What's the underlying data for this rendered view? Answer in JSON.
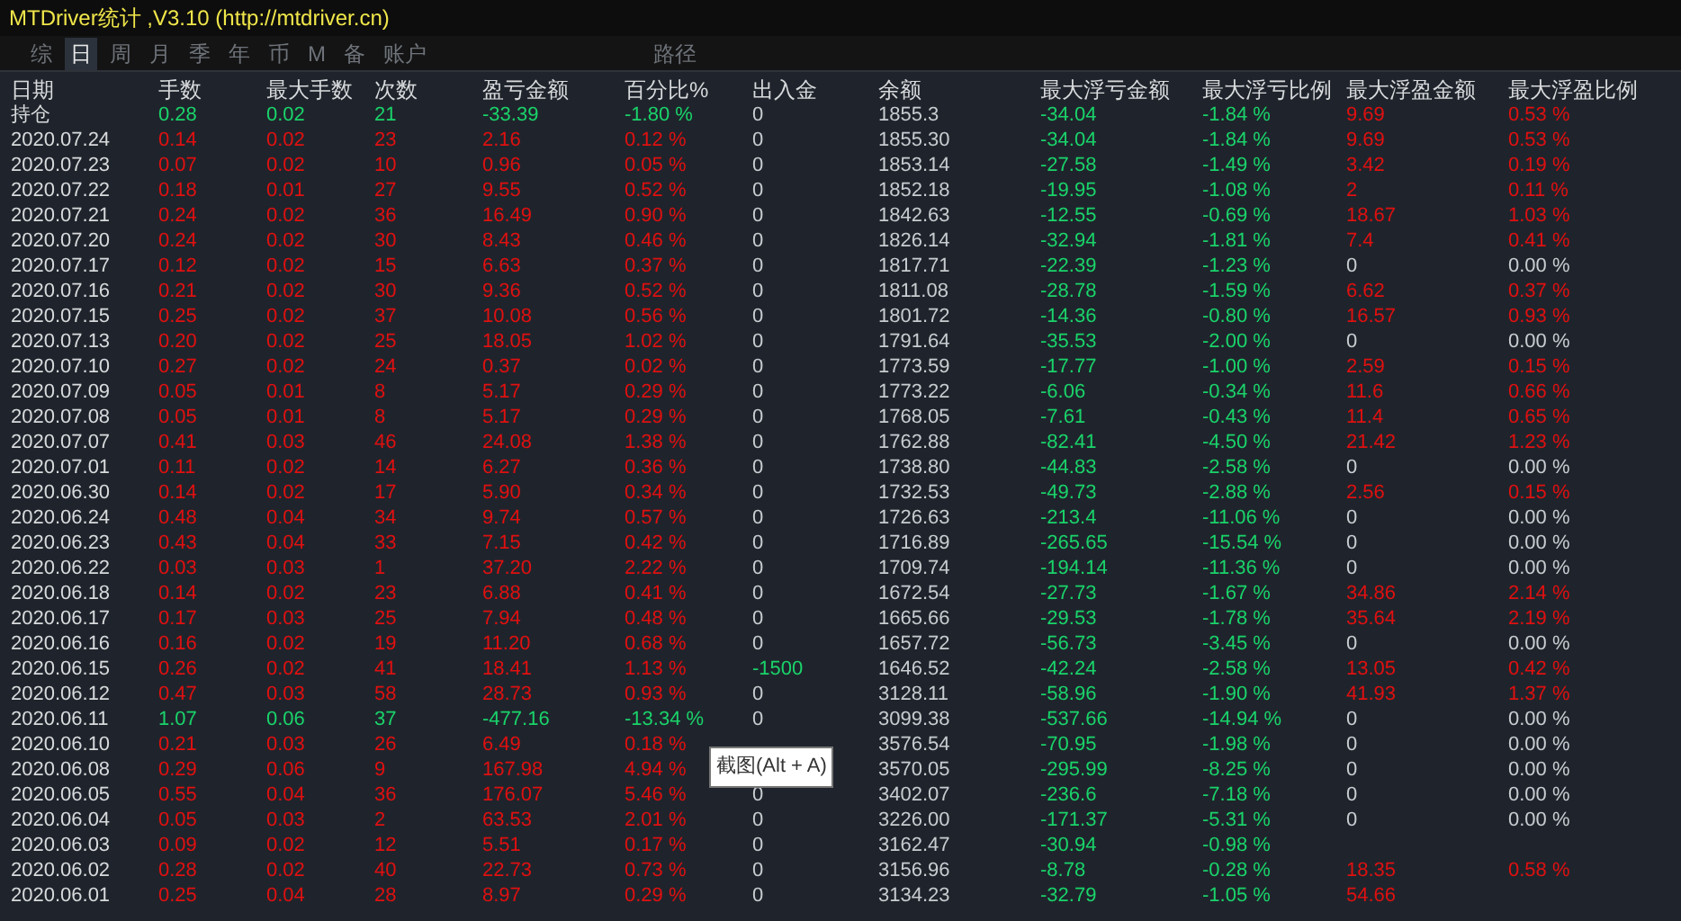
{
  "window": {
    "title": "MTDriver统计 ,V3.10 (http://mtdriver.cn)"
  },
  "tabs": [
    {
      "label": "综",
      "selected": false
    },
    {
      "label": "日",
      "selected": true
    },
    {
      "label": "周",
      "selected": false
    },
    {
      "label": "月",
      "selected": false
    },
    {
      "label": "季",
      "selected": false
    },
    {
      "label": "年",
      "selected": false
    },
    {
      "label": "币",
      "selected": false
    },
    {
      "label": "M",
      "selected": false
    },
    {
      "label": "备",
      "selected": false
    },
    {
      "label": "账户",
      "selected": false
    }
  ],
  "path_button": "路径",
  "table": {
    "columns": [
      "日期",
      "手数",
      "最大手数",
      "次数",
      "盈亏金额",
      "百分比%",
      "出入金",
      "余额",
      "最大浮亏金额",
      "最大浮亏比例",
      "最大浮盈金额",
      "最大浮盈比例"
    ],
    "rows": [
      {
        "profit": false,
        "withdrawal": false,
        "float_gain": true,
        "cells": [
          "持仓",
          "0.28",
          "0.02",
          "21",
          "-33.39",
          "-1.80 %",
          "0",
          "1855.3",
          "-34.04",
          "-1.84 %",
          "9.69",
          "0.53 %"
        ]
      },
      {
        "profit": true,
        "withdrawal": false,
        "float_gain": true,
        "cells": [
          "2020.07.24",
          "0.14",
          "0.02",
          "23",
          "2.16",
          "0.12 %",
          "0",
          "1855.30",
          "-34.04",
          "-1.84 %",
          "9.69",
          "0.53 %"
        ]
      },
      {
        "profit": true,
        "withdrawal": false,
        "float_gain": true,
        "cells": [
          "2020.07.23",
          "0.07",
          "0.02",
          "10",
          "0.96",
          "0.05 %",
          "0",
          "1853.14",
          "-27.58",
          "-1.49 %",
          "3.42",
          "0.19 %"
        ]
      },
      {
        "profit": true,
        "withdrawal": false,
        "float_gain": true,
        "cells": [
          "2020.07.22",
          "0.18",
          "0.01",
          "27",
          "9.55",
          "0.52 %",
          "0",
          "1852.18",
          "-19.95",
          "-1.08 %",
          "2",
          "0.11 %"
        ]
      },
      {
        "profit": true,
        "withdrawal": false,
        "float_gain": true,
        "cells": [
          "2020.07.21",
          "0.24",
          "0.02",
          "36",
          "16.49",
          "0.90 %",
          "0",
          "1842.63",
          "-12.55",
          "-0.69 %",
          "18.67",
          "1.03 %"
        ]
      },
      {
        "profit": true,
        "withdrawal": false,
        "float_gain": true,
        "cells": [
          "2020.07.20",
          "0.24",
          "0.02",
          "30",
          "8.43",
          "0.46 %",
          "0",
          "1826.14",
          "-32.94",
          "-1.81 %",
          "7.4",
          "0.41 %"
        ]
      },
      {
        "profit": true,
        "withdrawal": false,
        "float_gain": false,
        "cells": [
          "2020.07.17",
          "0.12",
          "0.02",
          "15",
          "6.63",
          "0.37 %",
          "0",
          "1817.71",
          "-22.39",
          "-1.23 %",
          "0",
          "0.00 %"
        ]
      },
      {
        "profit": true,
        "withdrawal": false,
        "float_gain": true,
        "cells": [
          "2020.07.16",
          "0.21",
          "0.02",
          "30",
          "9.36",
          "0.52 %",
          "0",
          "1811.08",
          "-28.78",
          "-1.59 %",
          "6.62",
          "0.37 %"
        ]
      },
      {
        "profit": true,
        "withdrawal": false,
        "float_gain": true,
        "cells": [
          "2020.07.15",
          "0.25",
          "0.02",
          "37",
          "10.08",
          "0.56 %",
          "0",
          "1801.72",
          "-14.36",
          "-0.80 %",
          "16.57",
          "0.93 %"
        ]
      },
      {
        "profit": true,
        "withdrawal": false,
        "float_gain": false,
        "cells": [
          "2020.07.13",
          "0.20",
          "0.02",
          "25",
          "18.05",
          "1.02 %",
          "0",
          "1791.64",
          "-35.53",
          "-2.00 %",
          "0",
          "0.00 %"
        ]
      },
      {
        "profit": true,
        "withdrawal": false,
        "float_gain": true,
        "cells": [
          "2020.07.10",
          "0.27",
          "0.02",
          "24",
          "0.37",
          "0.02 %",
          "0",
          "1773.59",
          "-17.77",
          "-1.00 %",
          "2.59",
          "0.15 %"
        ]
      },
      {
        "profit": true,
        "withdrawal": false,
        "float_gain": true,
        "cells": [
          "2020.07.09",
          "0.05",
          "0.01",
          "8",
          "5.17",
          "0.29 %",
          "0",
          "1773.22",
          "-6.06",
          "-0.34 %",
          "11.6",
          "0.66 %"
        ]
      },
      {
        "profit": true,
        "withdrawal": false,
        "float_gain": true,
        "cells": [
          "2020.07.08",
          "0.05",
          "0.01",
          "8",
          "5.17",
          "0.29 %",
          "0",
          "1768.05",
          "-7.61",
          "-0.43 %",
          "11.4",
          "0.65 %"
        ]
      },
      {
        "profit": true,
        "withdrawal": false,
        "float_gain": true,
        "cells": [
          "2020.07.07",
          "0.41",
          "0.03",
          "46",
          "24.08",
          "1.38 %",
          "0",
          "1762.88",
          "-82.41",
          "-4.50 %",
          "21.42",
          "1.23 %"
        ]
      },
      {
        "profit": true,
        "withdrawal": false,
        "float_gain": false,
        "cells": [
          "2020.07.01",
          "0.11",
          "0.02",
          "14",
          "6.27",
          "0.36 %",
          "0",
          "1738.80",
          "-44.83",
          "-2.58 %",
          "0",
          "0.00 %"
        ]
      },
      {
        "profit": true,
        "withdrawal": false,
        "float_gain": true,
        "cells": [
          "2020.06.30",
          "0.14",
          "0.02",
          "17",
          "5.90",
          "0.34 %",
          "0",
          "1732.53",
          "-49.73",
          "-2.88 %",
          "2.56",
          "0.15 %"
        ]
      },
      {
        "profit": true,
        "withdrawal": false,
        "float_gain": false,
        "cells": [
          "2020.06.24",
          "0.48",
          "0.04",
          "34",
          "9.74",
          "0.57 %",
          "0",
          "1726.63",
          "-213.4",
          "-11.06 %",
          "0",
          "0.00 %"
        ]
      },
      {
        "profit": true,
        "withdrawal": false,
        "float_gain": false,
        "cells": [
          "2020.06.23",
          "0.43",
          "0.04",
          "33",
          "7.15",
          "0.42 %",
          "0",
          "1716.89",
          "-265.65",
          "-15.54 %",
          "0",
          "0.00 %"
        ]
      },
      {
        "profit": true,
        "withdrawal": false,
        "float_gain": false,
        "cells": [
          "2020.06.22",
          "0.03",
          "0.03",
          "1",
          "37.20",
          "2.22 %",
          "0",
          "1709.74",
          "-194.14",
          "-11.36 %",
          "0",
          "0.00 %"
        ]
      },
      {
        "profit": true,
        "withdrawal": false,
        "float_gain": true,
        "cells": [
          "2020.06.18",
          "0.14",
          "0.02",
          "23",
          "6.88",
          "0.41 %",
          "0",
          "1672.54",
          "-27.73",
          "-1.67 %",
          "34.86",
          "2.14 %"
        ]
      },
      {
        "profit": true,
        "withdrawal": false,
        "float_gain": true,
        "cells": [
          "2020.06.17",
          "0.17",
          "0.03",
          "25",
          "7.94",
          "0.48 %",
          "0",
          "1665.66",
          "-29.53",
          "-1.78 %",
          "35.64",
          "2.19 %"
        ]
      },
      {
        "profit": true,
        "withdrawal": false,
        "float_gain": false,
        "cells": [
          "2020.06.16",
          "0.16",
          "0.02",
          "19",
          "11.20",
          "0.68 %",
          "0",
          "1657.72",
          "-56.73",
          "-3.45 %",
          "0",
          "0.00 %"
        ]
      },
      {
        "profit": true,
        "withdrawal": true,
        "float_gain": true,
        "cells": [
          "2020.06.15",
          "0.26",
          "0.02",
          "41",
          "18.41",
          "1.13 %",
          "-1500",
          "1646.52",
          "-42.24",
          "-2.58 %",
          "13.05",
          "0.42 %"
        ]
      },
      {
        "profit": true,
        "withdrawal": false,
        "float_gain": true,
        "cells": [
          "2020.06.12",
          "0.47",
          "0.03",
          "58",
          "28.73",
          "0.93 %",
          "0",
          "3128.11",
          "-58.96",
          "-1.90 %",
          "41.93",
          "1.37 %"
        ]
      },
      {
        "profit": false,
        "withdrawal": false,
        "float_gain": false,
        "cells": [
          "2020.06.11",
          "1.07",
          "0.06",
          "37",
          "-477.16",
          "-13.34 %",
          "0",
          "3099.38",
          "-537.66",
          "-14.94 %",
          "0",
          "0.00 %"
        ]
      },
      {
        "profit": true,
        "float_gain": false,
        "cells": [
          "2020.06.10",
          "0.21",
          "0.03",
          "26",
          "6.49",
          "0.18 %",
          null,
          "3576.54",
          "-70.95",
          "-1.98 %",
          "0",
          "0.00 %"
        ]
      },
      {
        "profit": true,
        "float_gain": false,
        "cells": [
          "2020.06.08",
          "0.29",
          "0.06",
          "9",
          "167.98",
          "4.94 %",
          null,
          "3570.05",
          "-295.99",
          "-8.25 %",
          "0",
          "0.00 %"
        ]
      },
      {
        "profit": true,
        "withdrawal": false,
        "float_gain": false,
        "cells": [
          "2020.06.05",
          "0.55",
          "0.04",
          "36",
          "176.07",
          "5.46 %",
          "0",
          "3402.07",
          "-236.6",
          "-7.18 %",
          "0",
          "0.00 %"
        ]
      },
      {
        "profit": true,
        "withdrawal": false,
        "float_gain": false,
        "cells": [
          "2020.06.04",
          "0.05",
          "0.03",
          "2",
          "63.53",
          "2.01 %",
          "0",
          "3226.00",
          "-171.37",
          "-5.31 %",
          "0",
          "0.00 %"
        ]
      },
      {
        "profit": true,
        "withdrawal": false,
        "cells": [
          "2020.06.03",
          "0.09",
          "0.02",
          "12",
          "5.51",
          "0.17 %",
          "0",
          "3162.47",
          "-30.94",
          "-0.98 %",
          null,
          null
        ]
      },
      {
        "profit": true,
        "withdrawal": false,
        "float_gain": true,
        "cells": [
          "2020.06.02",
          "0.28",
          "0.02",
          "40",
          "22.73",
          "0.73 %",
          "0",
          "3156.96",
          "-8.78",
          "-0.28 %",
          "18.35",
          "0.58 %"
        ]
      },
      {
        "profit": true,
        "withdrawal": false,
        "float_gain": true,
        "cells": [
          "2020.06.01",
          "0.25",
          "0.04",
          "28",
          "8.97",
          "0.29 %",
          "0",
          "3134.23",
          "-32.79",
          "-1.05 %",
          "54.66",
          null
        ]
      }
    ]
  },
  "tooltip": "截图(Alt + A)"
}
